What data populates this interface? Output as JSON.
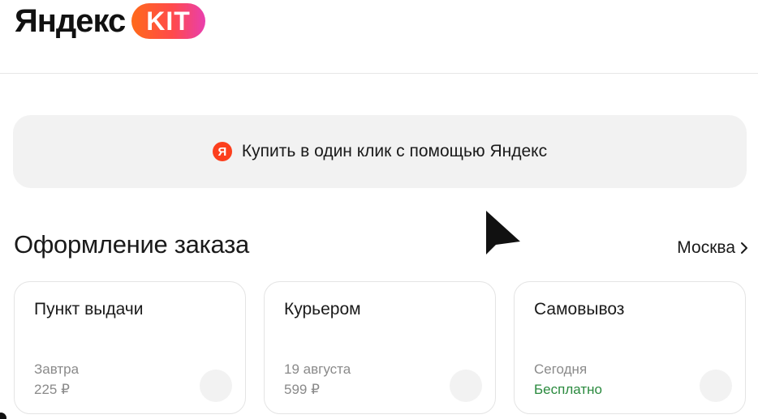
{
  "header": {
    "logo_word": "Яндекс",
    "logo_badge": "KIT"
  },
  "oneclick": {
    "icon_letter": "Я",
    "label": "Купить в один клик с помощью Яндекс"
  },
  "checkout": {
    "title": "Оформление заказа",
    "city": "Москва"
  },
  "delivery_options": [
    {
      "title": "Пункт выдачи",
      "date": "Завтра",
      "price": "225 ₽",
      "free": false
    },
    {
      "title": "Курьером",
      "date": "19 августа",
      "price": "599 ₽",
      "free": false
    },
    {
      "title": "Самовывоз",
      "date": "Сегодня",
      "price": "Бесплатно",
      "free": true
    }
  ],
  "colors": {
    "brand_red": "#fc3f1d",
    "free_green": "#2a8a3e",
    "muted_text": "#8a8a8a"
  }
}
